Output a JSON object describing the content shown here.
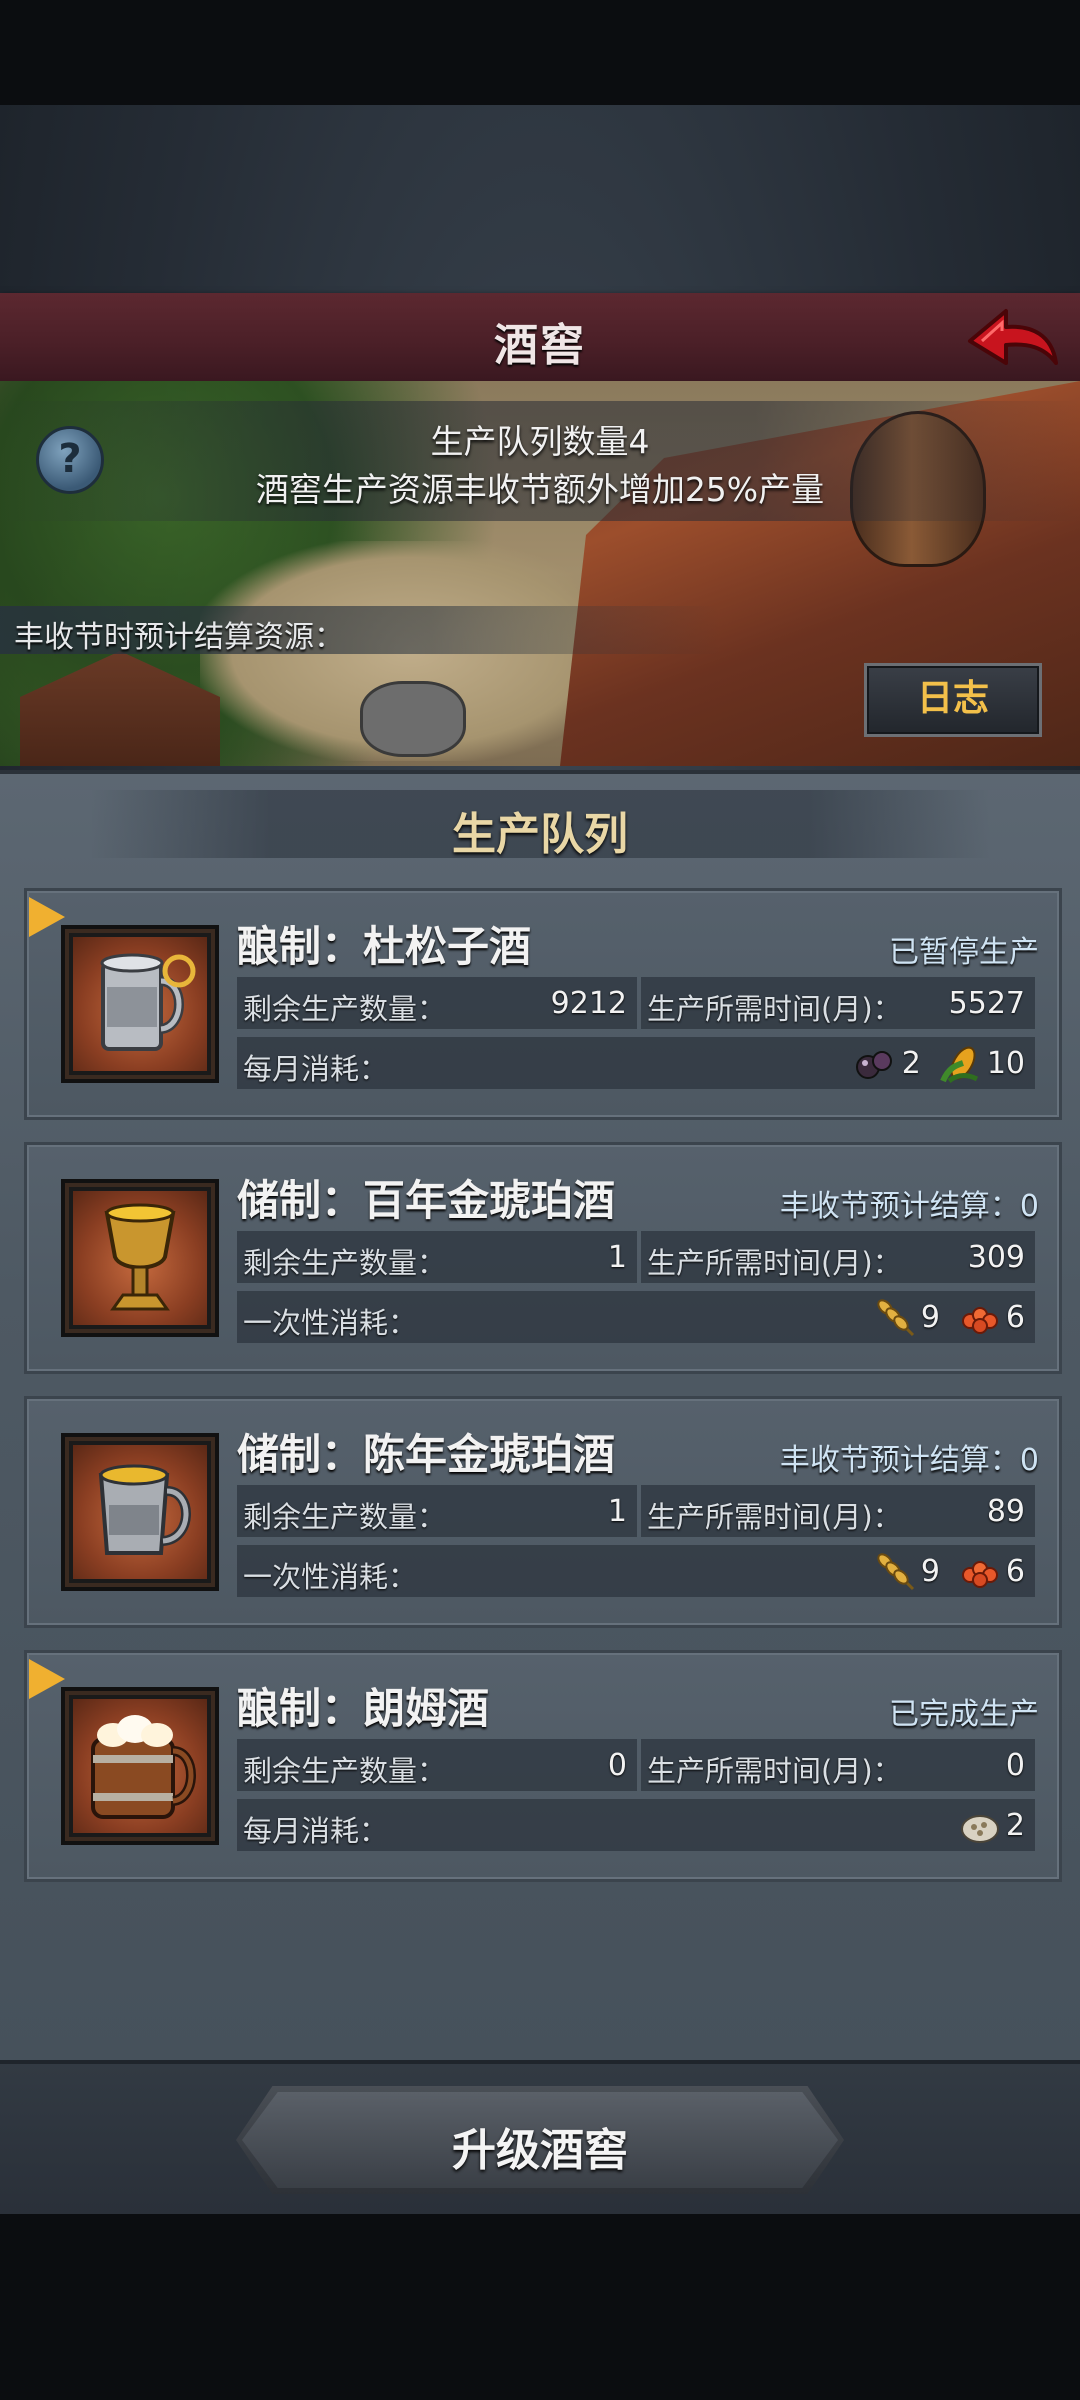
{
  "header": {
    "title": "酒窖"
  },
  "banner": {
    "queue_count": "生产队列数量4",
    "harvest_bonus": "酒窖生产资源丰收节额外增加25%产量",
    "harvest_settle_label": "丰收节时预计结算资源：",
    "log_button": "日志"
  },
  "queue": {
    "title": "生产队列",
    "items": [
      {
        "name": "酿制：杜松子酒",
        "status": "已暂停生产",
        "remaining_label": "剩余生产数量：",
        "remaining": "9212",
        "time_label": "生产所需时间(月)：",
        "time": "5527",
        "consume_label": "每月消耗：",
        "resources": [
          {
            "icon": "berries-icon",
            "amount": "2"
          },
          {
            "icon": "corn-icon",
            "amount": "10"
          }
        ]
      },
      {
        "name": "储制：百年金琥珀酒",
        "status": "丰收节预计结算：0",
        "remaining_label": "剩余生产数量：",
        "remaining": "1",
        "time_label": "生产所需时间(月)：",
        "time": "309",
        "consume_label": "一次性消耗：",
        "resources": [
          {
            "icon": "wheat-icon",
            "amount": "9"
          },
          {
            "icon": "roe-icon",
            "amount": "6"
          }
        ]
      },
      {
        "name": "储制：陈年金琥珀酒",
        "status": "丰收节预计结算：0",
        "remaining_label": "剩余生产数量：",
        "remaining": "1",
        "time_label": "生产所需时间(月)：",
        "time": "89",
        "consume_label": "一次性消耗：",
        "resources": [
          {
            "icon": "wheat-icon",
            "amount": "9"
          },
          {
            "icon": "roe-icon",
            "amount": "6"
          }
        ]
      },
      {
        "name": "酿制：朗姆酒",
        "status": "已完成生产",
        "remaining_label": "剩余生产数量：",
        "remaining": "0",
        "time_label": "生产所需时间(月)：",
        "time": "0",
        "consume_label": "每月消耗：",
        "resources": [
          {
            "icon": "grain-sack-icon",
            "amount": "2"
          }
        ]
      }
    ]
  },
  "footer": {
    "upgrade_button": "升级酒窖"
  }
}
